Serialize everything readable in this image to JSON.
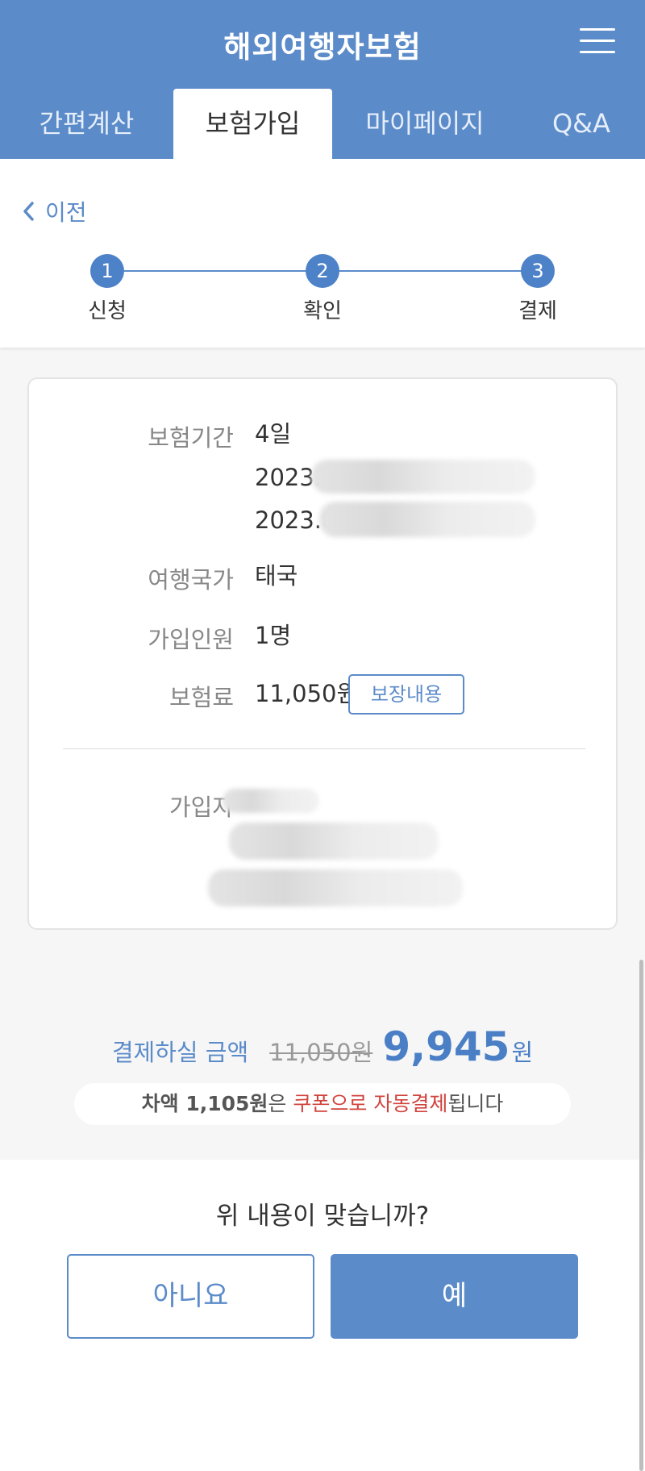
{
  "header": {
    "title": "해외여행자보험",
    "menu_icon": "hamburger-menu-icon",
    "tabs": [
      {
        "label": "간편계산",
        "active": false
      },
      {
        "label": "보험가입",
        "active": true
      },
      {
        "label": "마이페이지",
        "active": false
      },
      {
        "label": "Q&A",
        "active": false
      }
    ]
  },
  "nav": {
    "back_label": "이전",
    "back_icon": "chevron-left-icon"
  },
  "steps": [
    {
      "number": "1",
      "label": "신청"
    },
    {
      "number": "2",
      "label": "확인"
    },
    {
      "number": "3",
      "label": "결제"
    }
  ],
  "summary": {
    "period_label": "보험기간",
    "period_days": "4일",
    "period_start": "2023.",
    "period_end": "2023.0",
    "country_label": "여행국가",
    "country_value": "태국",
    "people_label": "가입인원",
    "people_value": "1명",
    "premium_label": "보험료",
    "premium_value": "11,050원",
    "coverage_button": "보장내용",
    "subscriber_label": "가입자"
  },
  "payment": {
    "label": "결제하실 금액",
    "original_price": "11,050원",
    "final_price": "9,945",
    "final_unit": "원",
    "notice_part1": "차액 1,105원",
    "notice_part2": "은 ",
    "notice_part3": "쿠폰으로 자동결제",
    "notice_part4": "됩니다"
  },
  "confirm": {
    "question": "위 내용이 맞습니까?",
    "no_label": "아니요",
    "yes_label": "예"
  },
  "colors": {
    "brand_blue": "#5b8bc9",
    "accent_red": "#d0433d"
  }
}
